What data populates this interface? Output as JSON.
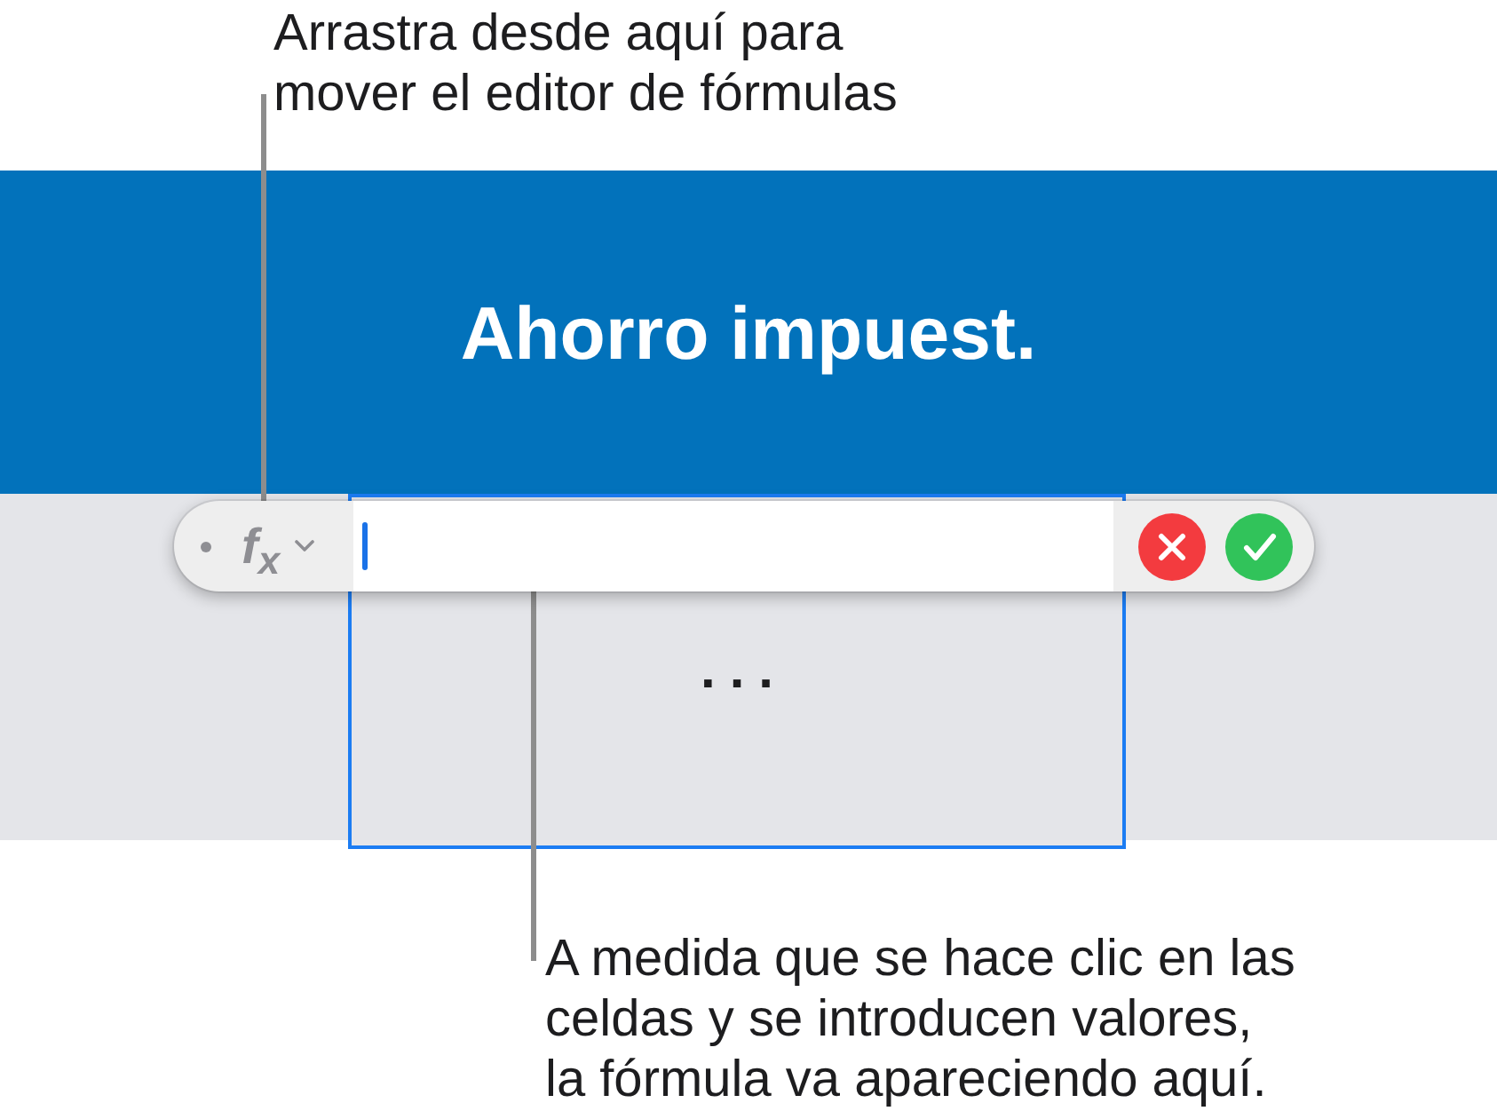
{
  "top_callout": {
    "text": "Arrastra desde aquí para\nmover el editor de fórmulas"
  },
  "table": {
    "header": {
      "title": "Ahorro impuest."
    },
    "cell": {
      "value": "...",
      "selected": true
    }
  },
  "formula_editor": {
    "function_button": {
      "label": "f$_{x}$"
    },
    "input": {
      "focused": true
    },
    "buttons": [
      {
        "kind": "cancel"
      },
      {
        "kind": "accept"
      }
    ]
  },
  "bottom_callout": {
    "text": "A medida que se hace clic en las\nceldas y se introducen valores,\nla fórmula va apareciendo aquí."
  }
}
